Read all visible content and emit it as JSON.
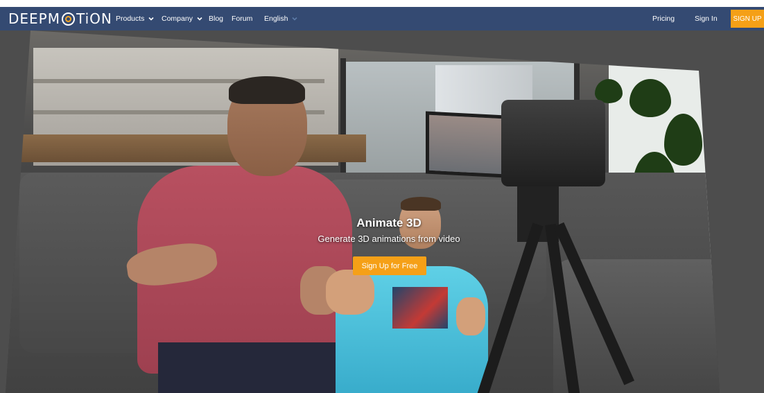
{
  "navbar": {
    "logo_text_1": "DEEPM",
    "logo_text_2": "TiON",
    "items": [
      {
        "label": "Products",
        "has_dropdown": true
      },
      {
        "label": "Company",
        "has_dropdown": true
      },
      {
        "label": "Blog",
        "has_dropdown": false
      },
      {
        "label": "Forum",
        "has_dropdown": false
      },
      {
        "label": "English",
        "has_dropdown": true
      }
    ],
    "pricing": "Pricing",
    "sign_in": "Sign In",
    "sign_up": "SIGN UP"
  },
  "hero": {
    "title": "Animate 3D",
    "subtitle": "Generate 3D animations from video",
    "cta": "Sign Up for Free"
  },
  "colors": {
    "navbar_bg": "#344a72",
    "accent": "#f5a017",
    "logo_o_ring": "#f5a623"
  },
  "icons": [
    "chevron-down-icon",
    "logo-o-icon"
  ]
}
